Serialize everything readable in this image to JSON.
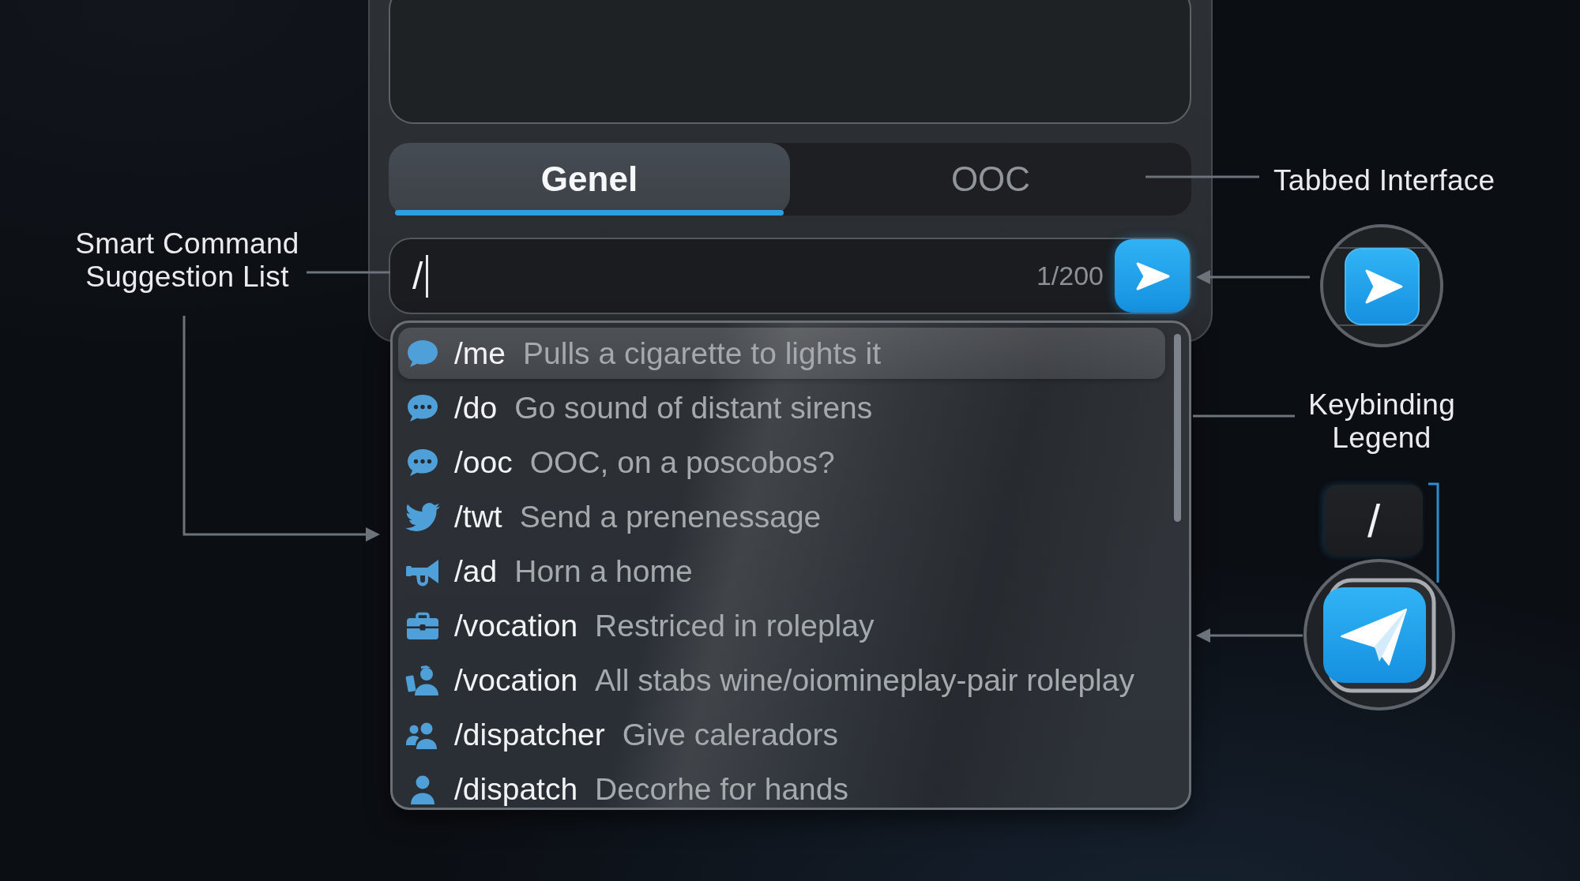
{
  "chat_panel": {
    "tabs": [
      {
        "label": "Genel",
        "selected": true
      },
      {
        "label": "OOC",
        "selected": false
      }
    ],
    "message_input": {
      "value": "/",
      "counter": "1/200"
    }
  },
  "command_suggestions": [
    {
      "command": "/me",
      "description": "Pulls a cigarette to lights it",
      "selected": true
    },
    {
      "command": "/do",
      "description": "Go sound of distant sirens",
      "selected": false
    },
    {
      "command": "/ooc",
      "description": "OOC, on a poscobos?",
      "selected": false
    },
    {
      "command": "/twt",
      "description": "Send a prenenessage",
      "selected": false
    },
    {
      "command": "/ad",
      "description": "Horn a home",
      "selected": false
    },
    {
      "command": "/vocation",
      "description": "Restriced in roleplay",
      "selected": false
    },
    {
      "command": "/vocation",
      "description": "All stabs wine/oiomineplay-pair roleplay",
      "selected": false
    },
    {
      "command": "/dispatcher",
      "description": "Give caleradors",
      "selected": false
    },
    {
      "command": "/dispatch",
      "description": "Decorhe for hands",
      "selected": false
    }
  ],
  "callouts": [
    {
      "label": "Tabbed Interface"
    },
    {
      "label": "Smart Command Suggestion List"
    },
    {
      "label": "Keybinding Legend",
      "key": "/"
    }
  ]
}
